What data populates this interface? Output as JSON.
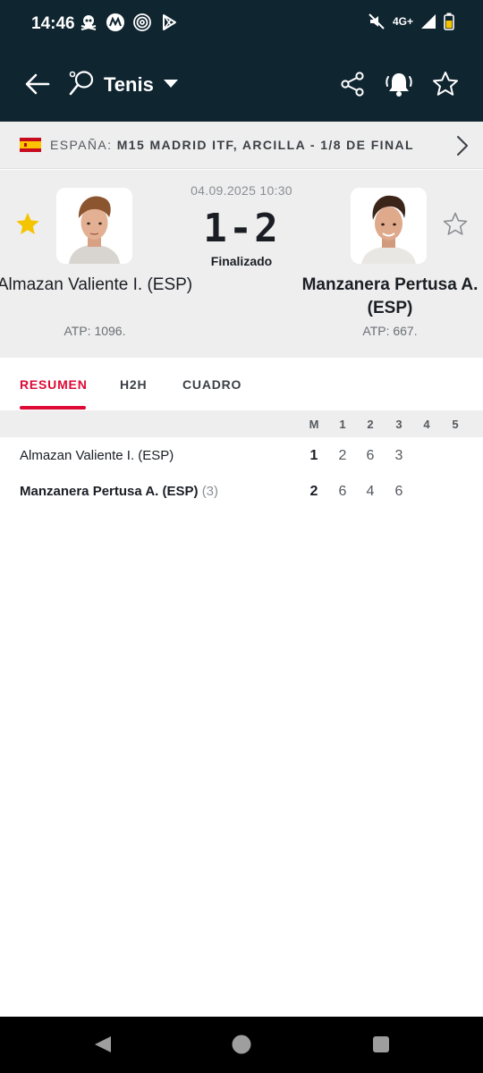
{
  "status_bar": {
    "time": "14:46",
    "network": "4G+",
    "icons": [
      "pirate-icon",
      "motorola-icon",
      "fingerprint-icon",
      "play-store-icon",
      "mute-icon",
      "signal-icon",
      "battery-icon"
    ]
  },
  "app_bar": {
    "sport": "Tenis",
    "icons": [
      "back-arrow-icon",
      "tennis-racket-icon",
      "chevron-down-icon",
      "share-icon",
      "bell-icon",
      "star-outline-icon"
    ]
  },
  "league": {
    "country": "ESPAÑA:",
    "name": "M15 MADRID ITF, ARCILLA - 1/8 DE FINAL"
  },
  "match": {
    "date": "04.09.2025 10:30",
    "score": "1-2",
    "status": "Finalizado",
    "home": {
      "name": "Almazan Valiente I. (ESP)",
      "rank": "ATP: 1096.",
      "favorite": true
    },
    "away": {
      "name": "Manzanera Pertusa A. (ESP)",
      "rank": "ATP: 667.",
      "favorite": false
    }
  },
  "tabs": [
    "RESUMEN",
    "H2H",
    "CUADRO"
  ],
  "active_tab": "RESUMEN",
  "scoreboard": {
    "columns": [
      "M",
      "1",
      "2",
      "3",
      "4",
      "5"
    ],
    "rows": [
      {
        "name": "Almazan Valiente I. (ESP)",
        "seed": "",
        "winner": false,
        "sets_won": "1",
        "sets": [
          "2",
          "6",
          "3",
          "",
          ""
        ]
      },
      {
        "name": "Manzanera Pertusa A. (ESP)",
        "seed": "(3)",
        "winner": true,
        "sets_won": "2",
        "sets": [
          "6",
          "4",
          "6",
          "",
          ""
        ]
      }
    ]
  },
  "colors": {
    "header_bg": "#0f2530",
    "accent": "#dd0a35",
    "star_active": "#f5c400",
    "panel_bg": "#eeeeee"
  }
}
